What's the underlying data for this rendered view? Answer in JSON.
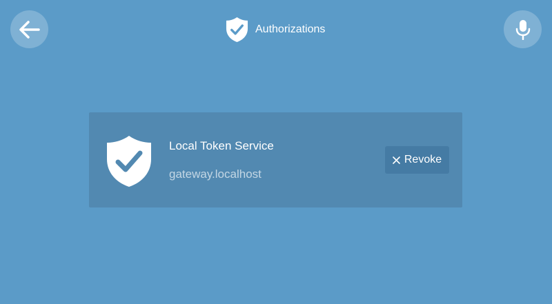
{
  "header": {
    "title": "Authorizations",
    "back_icon": "arrow-left-icon",
    "title_icon": "shield-check-icon",
    "mic_icon": "microphone-icon"
  },
  "authorizations": [
    {
      "name": "Local Token Service",
      "host": "gateway.localhost",
      "icon": "shield-check-icon",
      "revoke_label": "Revoke",
      "revoke_icon": "close-icon"
    }
  ],
  "colors": {
    "background": "#5b9bc8",
    "card": "#5289b1",
    "button": "#457ba4",
    "icon_check": "#5b9bc8"
  }
}
